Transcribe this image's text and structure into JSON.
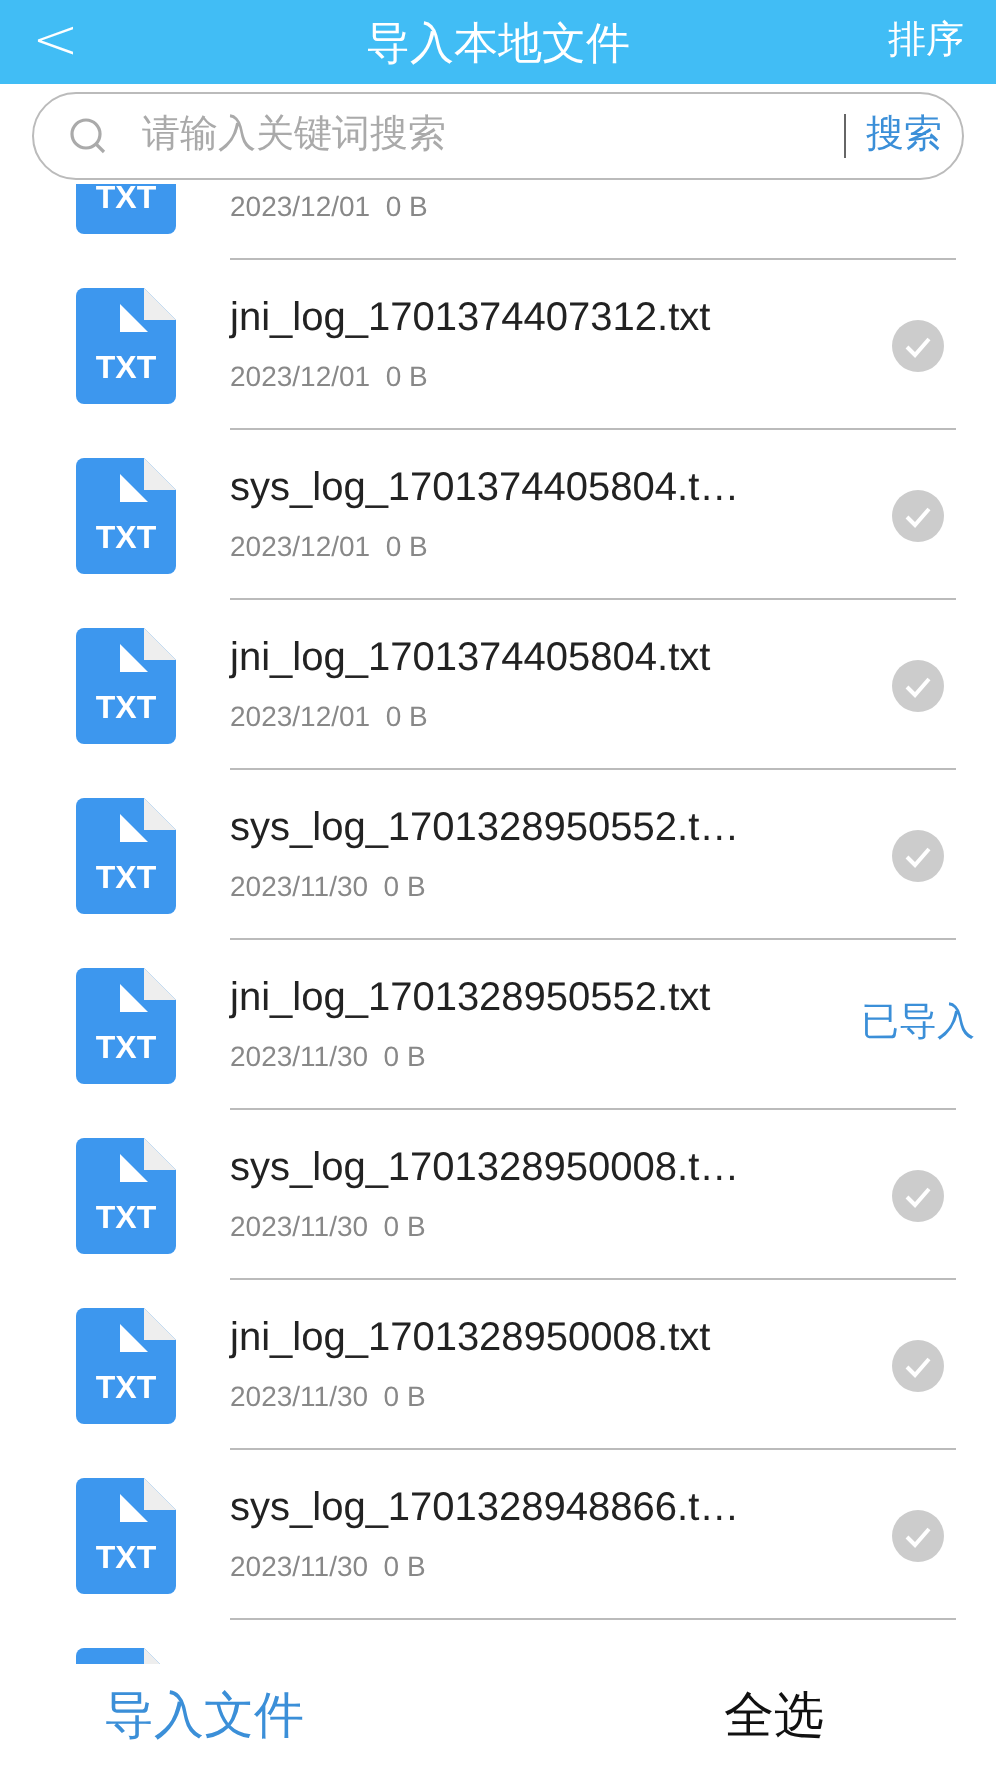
{
  "header": {
    "back": "<",
    "title": "导入本地文件",
    "sort": "排序"
  },
  "search": {
    "placeholder": "请输入关键词搜索",
    "button": "搜索"
  },
  "files": [
    {
      "date": "2023/12/01  0 B",
      "icon_label": "TXT"
    },
    {
      "name": "jni_log_1701374407312.txt",
      "date": "2023/12/01  0 B",
      "icon_label": "TXT",
      "kind": "check",
      "selected": false
    },
    {
      "name": "sys_log_1701374405804.t…",
      "date": "2023/12/01  0 B",
      "icon_label": "TXT",
      "kind": "check",
      "selected": false
    },
    {
      "name": "jni_log_1701374405804.txt",
      "date": "2023/12/01  0 B",
      "icon_label": "TXT",
      "kind": "check",
      "selected": false
    },
    {
      "name": "sys_log_1701328950552.t…",
      "date": "2023/11/30  0 B",
      "icon_label": "TXT",
      "kind": "check",
      "selected": false
    },
    {
      "name": "jni_log_1701328950552.txt",
      "date": "2023/11/30  0 B",
      "icon_label": "TXT",
      "kind": "imported",
      "status": "已导入"
    },
    {
      "name": "sys_log_1701328950008.t…",
      "date": "2023/11/30  0 B",
      "icon_label": "TXT",
      "kind": "check",
      "selected": false
    },
    {
      "name": "jni_log_1701328950008.txt",
      "date": "2023/11/30  0 B",
      "icon_label": "TXT",
      "kind": "check",
      "selected": false
    },
    {
      "name": "sys_log_1701328948866.t…",
      "date": "2023/11/30  0 B",
      "icon_label": "TXT",
      "kind": "check",
      "selected": false
    },
    {
      "kind": "icon_only"
    }
  ],
  "footer": {
    "import": "导入文件",
    "select_all": "全选"
  }
}
